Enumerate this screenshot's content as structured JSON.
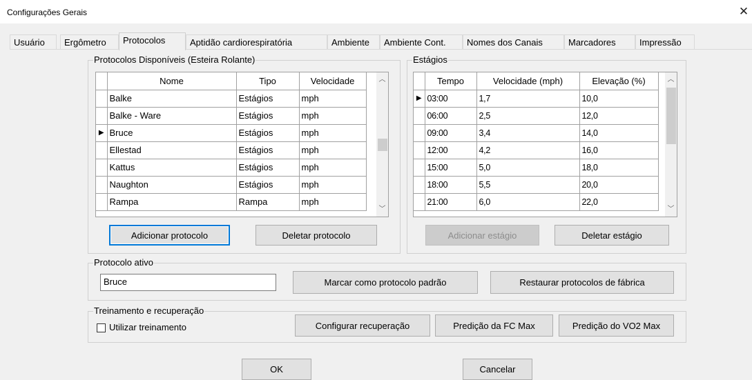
{
  "window": {
    "title": "Configurações Gerais",
    "close_glyph": "✕"
  },
  "tabs": [
    {
      "label": "Usuário"
    },
    {
      "label": "Ergômetro"
    },
    {
      "label": "Protocolos",
      "active": true
    },
    {
      "label": "Aptidão cardiorespiratória"
    },
    {
      "label": "Ambiente"
    },
    {
      "label": "Ambiente Cont."
    },
    {
      "label": "Nomes dos Canais"
    },
    {
      "label": "Marcadores"
    },
    {
      "label": "Impressão"
    }
  ],
  "protocols": {
    "group_label": "Protocolos Disponíveis (Esteira Rolante)",
    "columns": [
      "Nome",
      "Tipo",
      "Velocidade"
    ],
    "rows": [
      {
        "nome": "Balke",
        "tipo": "Estágios",
        "velocidade": "mph",
        "current": false
      },
      {
        "nome": "Balke - Ware",
        "tipo": "Estágios",
        "velocidade": "mph",
        "current": false
      },
      {
        "nome": "Bruce",
        "tipo": "Estágios",
        "velocidade": "mph",
        "current": true
      },
      {
        "nome": "Ellestad",
        "tipo": "Estágios",
        "velocidade": "mph",
        "current": false
      },
      {
        "nome": "Kattus",
        "tipo": "Estágios",
        "velocidade": "mph",
        "current": false
      },
      {
        "nome": "Naughton",
        "tipo": "Estágios",
        "velocidade": "mph",
        "current": false
      },
      {
        "nome": "Rampa",
        "tipo": "Rampa",
        "velocidade": "mph",
        "current": false
      }
    ],
    "add_button": {
      "label": "Adicionar protocolo",
      "mnemonic": "A"
    },
    "delete_button": {
      "label": "Deletar  protocolo",
      "mnemonic": "D"
    }
  },
  "stages": {
    "group_label": "Estágios",
    "columns": [
      "Tempo",
      "Velocidade (mph)",
      "Elevação (%)"
    ],
    "rows": [
      {
        "tempo": "03:00",
        "velocidade": "1,7",
        "elevacao": "10,0",
        "current": true
      },
      {
        "tempo": "06:00",
        "velocidade": "2,5",
        "elevacao": "12,0",
        "current": false
      },
      {
        "tempo": "09:00",
        "velocidade": "3,4",
        "elevacao": "14,0",
        "current": false
      },
      {
        "tempo": "12:00",
        "velocidade": "4,2",
        "elevacao": "16,0",
        "current": false
      },
      {
        "tempo": "15:00",
        "velocidade": "5,0",
        "elevacao": "18,0",
        "current": false
      },
      {
        "tempo": "18:00",
        "velocidade": "5,5",
        "elevacao": "20,0",
        "current": false
      },
      {
        "tempo": "21:00",
        "velocidade": "6,0",
        "elevacao": "22,0",
        "current": false
      }
    ],
    "add_button": {
      "label": "Adicionar estágio",
      "disabled": true
    },
    "delete_button": {
      "label": "Deletar estágio"
    }
  },
  "active_protocol": {
    "group_label": "Protocolo ativo",
    "value": "Bruce",
    "set_default_button": "Marcar como protocolo padrão",
    "restore_button": "Restaurar protocolos de fábrica"
  },
  "training": {
    "group_label": "Treinamento e recuperação",
    "checkbox_label": "Utilizar treinamento",
    "checkbox_checked": false,
    "config_recovery_button": "Configurar  recuperação",
    "fc_max_button": "Predição da FC Max",
    "vo2_max_button": "Predição do VO2 Max"
  },
  "dialog": {
    "ok_label": "OK",
    "cancel_label": "Cancelar"
  },
  "colors": {
    "focus": "#0078d7",
    "window_bg": "#f0f0f0"
  }
}
